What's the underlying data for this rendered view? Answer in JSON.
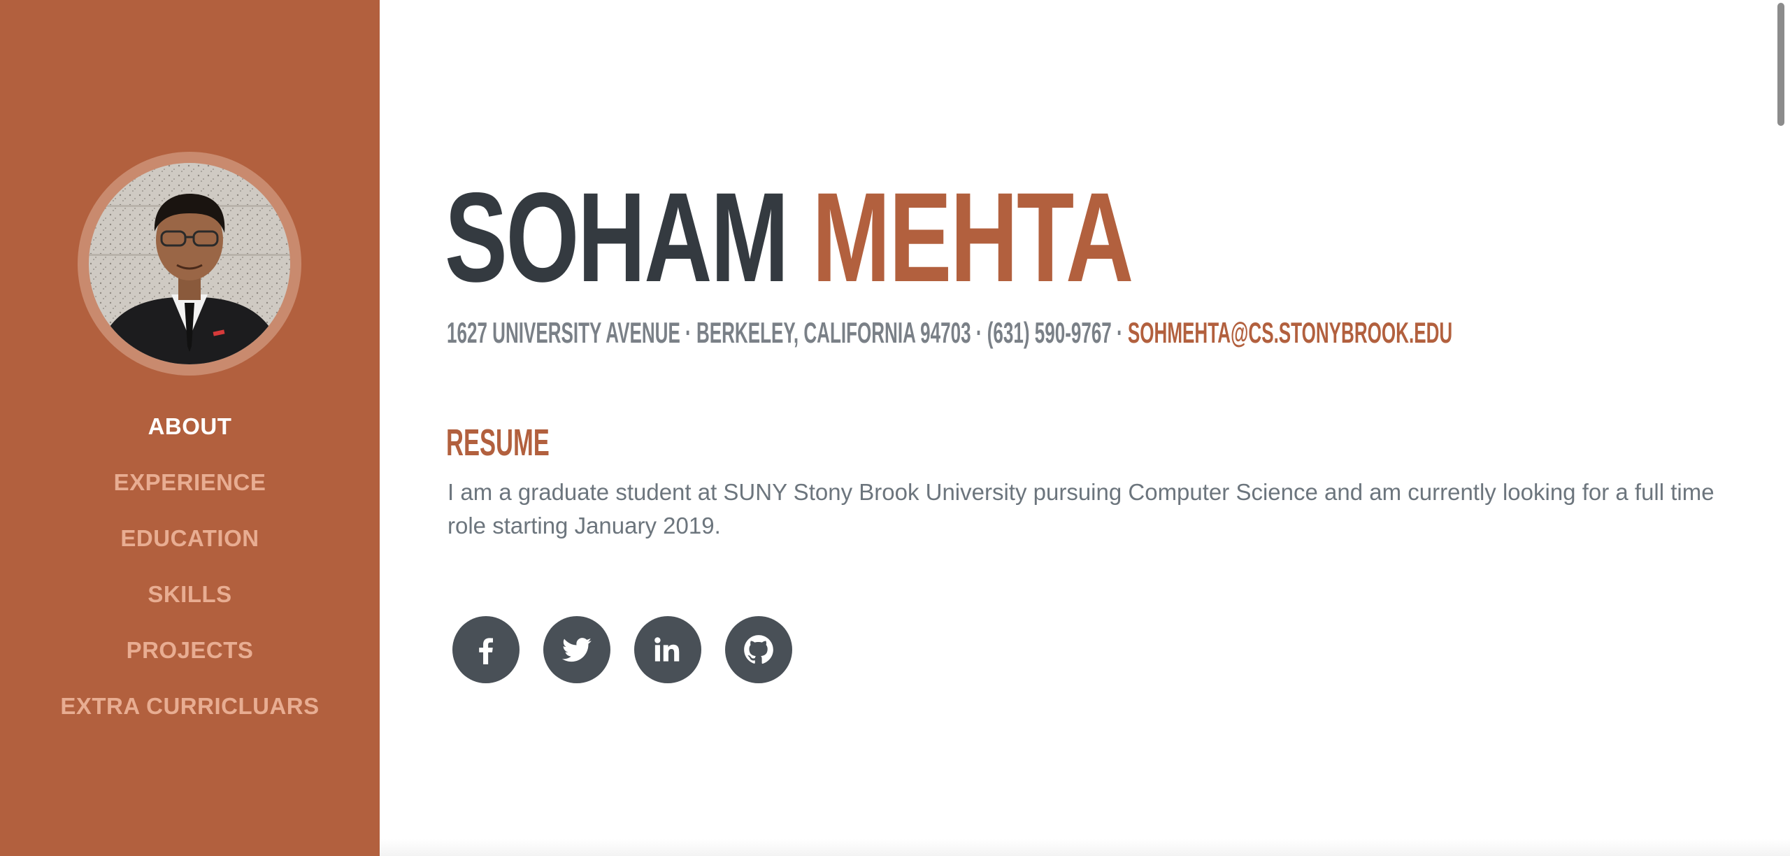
{
  "profile": {
    "first_name": "SOHAM",
    "last_name": "MEHTA",
    "address": "1627 UNIVERSITY AVENUE · BERKELEY, CALIFORNIA 94703 · (631) 590-9767 · ",
    "email": "SOHMEHTA@CS.STONYBROOK.EDU"
  },
  "nav": {
    "items": [
      {
        "label": "ABOUT",
        "active": true
      },
      {
        "label": "EXPERIENCE",
        "active": false
      },
      {
        "label": "EDUCATION",
        "active": false
      },
      {
        "label": "SKILLS",
        "active": false
      },
      {
        "label": "PROJECTS",
        "active": false
      },
      {
        "label": "EXTRA CURRICLUARS",
        "active": false
      }
    ]
  },
  "about": {
    "heading": "RESUME",
    "text": "I am a graduate student at SUNY Stony Brook University pursuing Computer Science and am currently looking for a full time role starting January 2019."
  },
  "social": {
    "icons": [
      "facebook-icon",
      "twitter-icon",
      "linkedin-icon",
      "github-icon"
    ]
  },
  "colors": {
    "primary": "#b2603e",
    "sidebar_inactive": "#e8ad92",
    "dark": "#343a40",
    "muted": "#6c757d",
    "social_bg": "#495057"
  }
}
